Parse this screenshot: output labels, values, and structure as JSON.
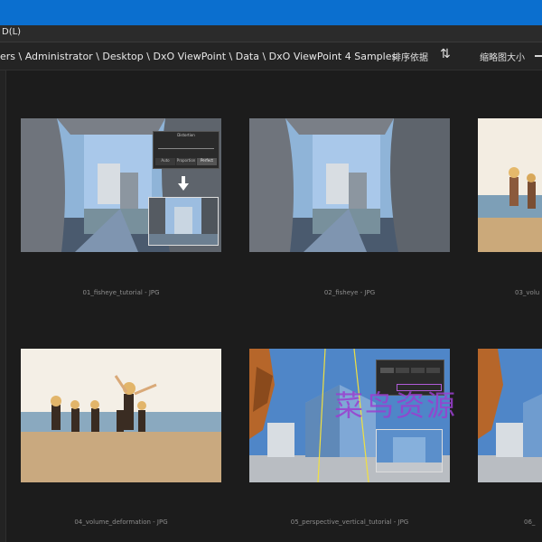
{
  "menu": {
    "item": "D(L)"
  },
  "breadcrumb": "ers \\ Administrator \\ Desktop \\ DxO ViewPoint \\ Data \\ DxO ViewPoint 4 Samples",
  "toolbar": {
    "sort_label": "排序依据",
    "sort_icon": "⇅",
    "thumb_size_label": "缩略图大小"
  },
  "thumbnails": [
    {
      "caption": "01_fisheye_tutorial - JPG"
    },
    {
      "caption": "02_fisheye - JPG"
    },
    {
      "caption": "03_volu"
    },
    {
      "caption": "04_volume_deformation - JPG"
    },
    {
      "caption": "05_perspective_vertical_tutorial - JPG"
    },
    {
      "caption": "06_"
    }
  ],
  "overlay_panel": {
    "title": "Distortion",
    "buttons": [
      "Auto",
      "Proportion",
      "Perfect"
    ]
  },
  "watermark": "菜鸟资源"
}
